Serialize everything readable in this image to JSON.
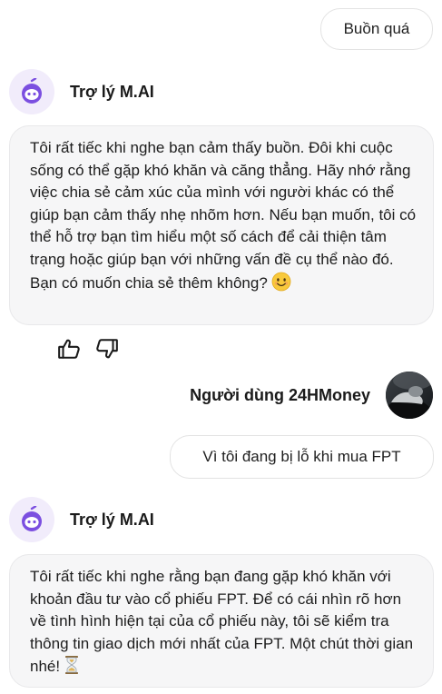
{
  "messages": {
    "user_1": {
      "text": "Buồn quá"
    },
    "bot_1": {
      "name": "Trợ lý M.AI",
      "text": "Tôi rất tiếc khi nghe bạn cảm thấy buồn. Đôi khi cuộc sống có thể gặp khó khăn và căng thẳng. Hãy nhớ rằng việc chia sẻ cảm xúc của mình với người khác có thể giúp bạn cảm thấy nhẹ nhõm hơn. Nếu bạn muốn, tôi có thể hỗ trợ bạn tìm hiểu một số cách để cải thiện tâm trạng hoặc giúp bạn với những vấn đề cụ thể nào đó. Bạn có muốn chia sẻ thêm không?"
    },
    "user_2": {
      "name": "Người dùng 24HMoney",
      "text": "Vì tôi đang bị lỗ khi mua FPT"
    },
    "bot_2": {
      "name": "Trợ lý M.AI",
      "text": "Tôi rất tiếc khi nghe rằng bạn đang gặp khó khăn với khoản đầu tư vào cổ phiếu FPT. Để có cái nhìn rõ hơn về tình hình hiện tại của cổ phiếu này, tôi sẽ kiểm tra thông tin giao dịch mới nhất của FPT. Một chút thời gian nhé!"
    }
  },
  "icons": {
    "bot_avatar": "robot-face-icon",
    "smile_emoji": "smiling-face-icon",
    "hourglass_emoji": "hourglass-icon",
    "thumbs_up": "thumbs-up-icon",
    "thumbs_down": "thumbs-down-icon",
    "user_avatar": "user-photo-avatar"
  },
  "colors": {
    "bot_bubble_bg": "#f6f6f7",
    "bot_avatar_bg": "#f1ecfb",
    "bot_accent": "#7b4fe0",
    "user_bubble_border": "#e3e3e3"
  }
}
